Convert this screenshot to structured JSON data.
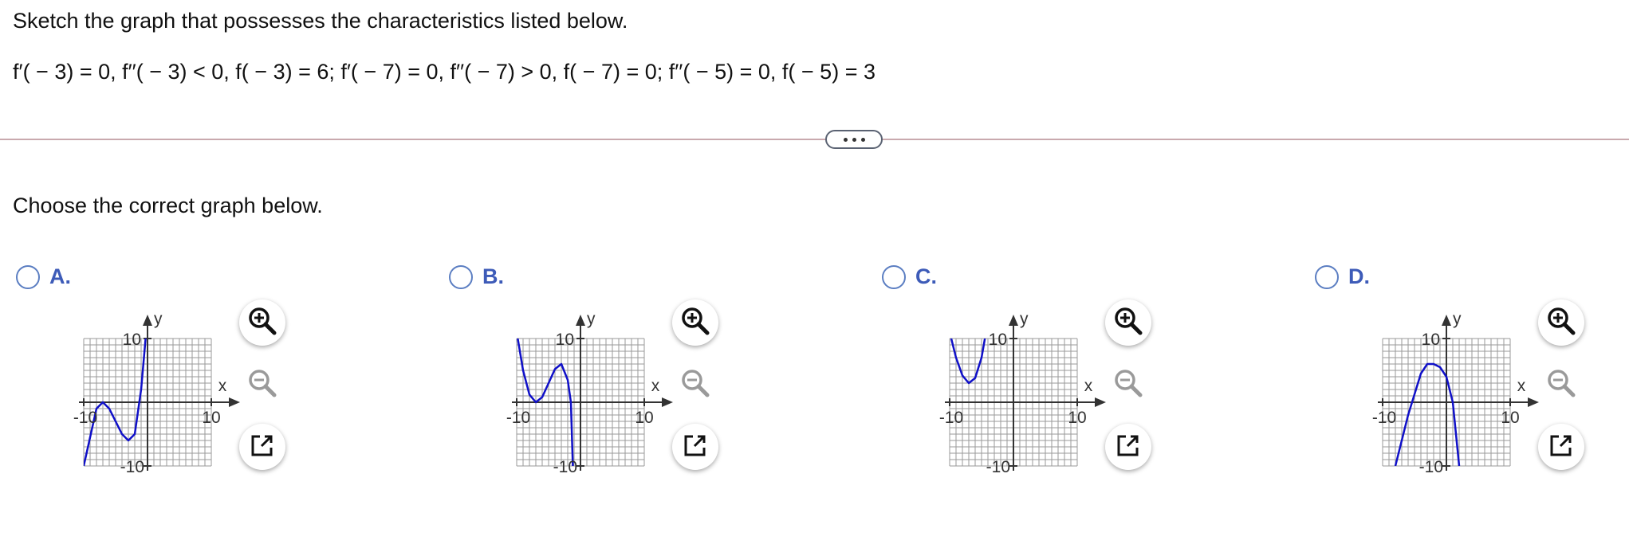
{
  "question": {
    "prompt": "Sketch the graph that possesses the characteristics listed below.",
    "conditions": "f′( − 3) = 0, f′′( − 3) < 0, f( − 3) = 6; f′( − 7) = 0, f′′( − 7) > 0, f( − 7) = 0; f′′( − 5) = 0, f( − 5) = 3",
    "instruction": "Choose the correct graph below."
  },
  "options": [
    {
      "letter": "A.",
      "selected": false
    },
    {
      "letter": "B.",
      "selected": false
    },
    {
      "letter": "C.",
      "selected": false
    },
    {
      "letter": "D.",
      "selected": false
    }
  ],
  "graph_labels": {
    "x_axis": "x",
    "y_axis": "y",
    "y_max_tick": "10",
    "y_min_tick": "-10",
    "x_min_tick": "-10",
    "x_max_tick": "10"
  },
  "icons": {
    "zoom_in": "zoom-in-icon",
    "zoom_out": "zoom-out-icon",
    "popout": "popout-icon"
  },
  "colors": {
    "curve": "#1010c8",
    "radio": "#5b7ec2",
    "option_letter": "#3d5bb8",
    "divider": "#c9a9ae"
  },
  "chart_data": [
    {
      "type": "line",
      "xlim": [
        -10,
        10
      ],
      "ylim": [
        -10,
        10
      ],
      "grid": true,
      "series": [
        {
          "x": [
            -10,
            -8,
            -7,
            -6,
            -5,
            -4,
            -3,
            -2,
            -1,
            -0.3
          ],
          "values": [
            -10,
            -1,
            0,
            -1,
            -3,
            -5,
            -6,
            -5,
            2,
            10
          ]
        }
      ]
    },
    {
      "type": "line",
      "xlim": [
        -10,
        10
      ],
      "ylim": [
        -10,
        10
      ],
      "grid": true,
      "series": [
        {
          "x": [
            -10,
            -9,
            -8,
            -7,
            -6,
            -5,
            -4,
            -3,
            -2,
            -1.5,
            -1.2
          ],
          "values": [
            11,
            5,
            1.2,
            0,
            0.8,
            3,
            5.2,
            6,
            3.5,
            0,
            -10
          ]
        }
      ]
    },
    {
      "type": "line",
      "xlim": [
        -10,
        10
      ],
      "ylim": [
        -10,
        10
      ],
      "grid": true,
      "series": [
        {
          "x": [
            -10,
            -9,
            -8,
            -7,
            -6,
            -5,
            -4.3
          ],
          "values": [
            11,
            7,
            4.2,
            3,
            3.8,
            7,
            11
          ]
        }
      ]
    },
    {
      "type": "line",
      "xlim": [
        -10,
        10
      ],
      "ylim": [
        -10,
        10
      ],
      "grid": true,
      "series": [
        {
          "x": [
            -8,
            -6,
            -4,
            -3,
            -2,
            -1,
            0,
            1,
            2
          ],
          "values": [
            -10,
            -2,
            4.5,
            6,
            6,
            5.5,
            4,
            0,
            -10
          ]
        }
      ]
    }
  ]
}
